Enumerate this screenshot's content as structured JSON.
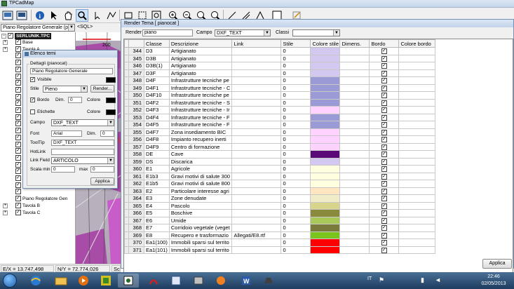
{
  "app": {
    "title": "TPCadMap",
    "theme_combo": "Piano Regolatore Generale (piar",
    "sql_label": "<SQL>",
    "scale_label": "200"
  },
  "toolbar": {
    "icons": [
      "open-icon",
      "save-icon",
      "info-icon",
      "select-arrow-icon",
      "pan-hand-icon",
      "zoom-icon",
      "pointer-icon",
      "polyline-icon",
      "rectangle-icon",
      "zoom-in-icon",
      "zoom-out-icon",
      "zoom-extent-icon",
      "zoom-window-icon",
      "draw-line-icon",
      "measure-icon",
      "snap-icon",
      "edit-icon"
    ]
  },
  "tree": {
    "root": "SERLUNIK.TPC",
    "items": [
      {
        "label": "Base",
        "expand": "+",
        "checked": true
      },
      {
        "label": "Tavola A",
        "expand": "+",
        "checked": true
      },
      {
        "label": "",
        "expand": "",
        "checked": true
      },
      {
        "label": "",
        "expand": "",
        "checked": true
      },
      {
        "label": "",
        "expand": "",
        "checked": true
      },
      {
        "label": "",
        "expand": "",
        "checked": true
      },
      {
        "label": "",
        "expand": "",
        "checked": true
      },
      {
        "label": "",
        "expand": "",
        "checked": true
      },
      {
        "label": "",
        "expand": "",
        "checked": true
      },
      {
        "label": "",
        "expand": "",
        "checked": true
      },
      {
        "label": "",
        "expand": "",
        "checked": true
      },
      {
        "label": "",
        "expand": "",
        "checked": true
      },
      {
        "label": "",
        "expand": "",
        "checked": true
      },
      {
        "label": "",
        "expand": "",
        "checked": true
      },
      {
        "label": "",
        "expand": "",
        "checked": true
      },
      {
        "label": "",
        "expand": "",
        "checked": true
      },
      {
        "label": "",
        "expand": "",
        "checked": true
      },
      {
        "label": "",
        "expand": "",
        "checked": true
      },
      {
        "label": "",
        "expand": "",
        "checked": true
      },
      {
        "label": "",
        "expand": "",
        "checked": true
      },
      {
        "label": "",
        "expand": "",
        "checked": true
      },
      {
        "label": "",
        "expand": "",
        "checked": true
      },
      {
        "label": "",
        "expand": "",
        "checked": true
      },
      {
        "label": "Piano Regolatore Gen",
        "expand": "",
        "checked": true
      },
      {
        "label": "Tavola B",
        "expand": "+",
        "checked": true
      },
      {
        "label": "Tavola C",
        "expand": "+",
        "checked": true
      }
    ]
  },
  "elenco": {
    "title": "Elenco temi",
    "group_title": "Dettagli (pianocat)",
    "desc_value": "Piano Regolatore Generale",
    "visibile_label": "Visibile",
    "stile_label": "Stile",
    "stile_value": "Pieno",
    "render_button": "Render...",
    "bordo_label": "Bordo",
    "dim_label": "Dim.",
    "dim_value": "0",
    "colore_label": "Colore",
    "etichette_label": "Etichette",
    "colore2_label": "Colore",
    "campo_label": "Campo",
    "campo_value": "DXF_TEXT",
    "font_label": "Font",
    "font_value": "Arial",
    "dim2_label": "Dim.",
    "dim2_value": "0",
    "tooltip_label": "ToolTip",
    "tooltip_value": "DXF_TEXT",
    "hotlink_label": "HotLink",
    "hotlink_value": "",
    "linkfield_label": "Link Field",
    "linkfield_value": "ARTICOLO",
    "scalamin_label": "Scala min",
    "scalamin_value": "0",
    "max_label": "max",
    "max_value": "0",
    "applica_button": "Applica"
  },
  "render": {
    "title": "Render Tema [ pianocat ]",
    "render_label": "Render",
    "render_value": "piano",
    "campo_label": "Campo",
    "campo_value": "DXF_TEXT",
    "classi_label": "Classi",
    "classi_value": "",
    "columns": [
      "",
      "Classe",
      "Descrizione",
      "Link",
      "Stile",
      "Colore stile",
      "Dimens.",
      "Bordo",
      "Colore bordo"
    ],
    "rows": [
      {
        "n": "344",
        "classe": "D3",
        "desc": "Artigianato",
        "link": "",
        "stile": "0",
        "color": "#d2c8f0"
      },
      {
        "n": "345",
        "classe": "D3B",
        "desc": "Artigianato",
        "link": "",
        "stile": "0",
        "color": "#d2c8f0"
      },
      {
        "n": "346",
        "classe": "D3B(1)",
        "desc": "Artigianato",
        "link": "",
        "stile": "0",
        "color": "#d2c8f0"
      },
      {
        "n": "347",
        "classe": "D3F",
        "desc": "Artigianato",
        "link": "",
        "stile": "0",
        "color": "#d2c8f0"
      },
      {
        "n": "348",
        "classe": "D4F",
        "desc": "Infrastrutture tecniche pe",
        "link": "",
        "stile": "0",
        "color": "#9a9ad6"
      },
      {
        "n": "349",
        "classe": "D4F1",
        "desc": "Infrastrutture tecniche - C",
        "link": "",
        "stile": "0",
        "color": "#9a9ad6"
      },
      {
        "n": "350",
        "classe": "D4F10",
        "desc": "Infrastrutture tecniche pe",
        "link": "",
        "stile": "0",
        "color": "#9a9ad6"
      },
      {
        "n": "351",
        "classe": "D4F2",
        "desc": "Infrastrutture tecniche - S",
        "link": "",
        "stile": "0",
        "color": "#9a9ad6"
      },
      {
        "n": "352",
        "classe": "D4F3",
        "desc": "Infrastrutture tecniche - Ir",
        "link": "",
        "stile": "0",
        "color": "#ffd2ff"
      },
      {
        "n": "353",
        "classe": "D4F4",
        "desc": "Infrastrutture tecniche - F",
        "link": "",
        "stile": "0",
        "color": "#9a9ad6"
      },
      {
        "n": "354",
        "classe": "D4F5",
        "desc": "Infrastrutture tecniche - F",
        "link": "",
        "stile": "0",
        "color": "#9a9ad6"
      },
      {
        "n": "355",
        "classe": "D4F7",
        "desc": "Zona insediamento BIC",
        "link": "",
        "stile": "0",
        "color": "#ffd2ff"
      },
      {
        "n": "356",
        "classe": "D4F8",
        "desc": "Impianto recupero inerti",
        "link": "",
        "stile": "0",
        "color": "#ffd2ff"
      },
      {
        "n": "357",
        "classe": "D4F9",
        "desc": "Centro di formazione",
        "link": "",
        "stile": "0",
        "color": "#ffd2ff"
      },
      {
        "n": "358",
        "classe": "DE",
        "desc": "Cave",
        "link": "",
        "stile": "0",
        "color": "#5a0a78"
      },
      {
        "n": "359",
        "classe": "DS",
        "desc": "Discarica",
        "link": "",
        "stile": "0",
        "color": "#d2c8f0"
      },
      {
        "n": "360",
        "classe": "E1",
        "desc": "Agricole",
        "link": "",
        "stile": "0",
        "color": "#ffffe0"
      },
      {
        "n": "361",
        "classe": "E1b3",
        "desc": "Gravi motivi di salute 300",
        "link": "",
        "stile": "0",
        "color": "#ffffe0"
      },
      {
        "n": "362",
        "classe": "E1b5",
        "desc": "Gravi motivi di salute 800",
        "link": "",
        "stile": "0",
        "color": "#ffffe0"
      },
      {
        "n": "363",
        "classe": "E2",
        "desc": "Particolare interesse agri",
        "link": "",
        "stile": "0",
        "color": "#ffe6c0"
      },
      {
        "n": "364",
        "classe": "E3",
        "desc": "Zone denudate",
        "link": "",
        "stile": "0",
        "color": "#f0ecc8"
      },
      {
        "n": "365",
        "classe": "E4",
        "desc": "Pascolo",
        "link": "",
        "stile": "0",
        "color": "#d8d48c"
      },
      {
        "n": "366",
        "classe": "E5",
        "desc": "Boschive",
        "link": "",
        "stile": "0",
        "color": "#8a8a3c"
      },
      {
        "n": "367",
        "classe": "E6",
        "desc": "Umide",
        "link": "",
        "stile": "0",
        "color": "#a8c85a"
      },
      {
        "n": "368",
        "classe": "E7",
        "desc": "Corridoio vegetale (veget",
        "link": "",
        "stile": "0",
        "color": "#7a7a3a"
      },
      {
        "n": "369",
        "classe": "E8",
        "desc": "Recupero e trasformazio",
        "link": "Allegati/E8.rtf",
        "stile": "0",
        "color": "#7ac41e"
      },
      {
        "n": "370",
        "classe": "Ea1(100)",
        "desc": "Immobili sparsi sul territo",
        "link": "",
        "stile": "0",
        "color": "#ff0000"
      },
      {
        "n": "371",
        "classe": "Ea1(101)",
        "desc": "Immobili sparsi sul territo",
        "link": "",
        "stile": "0",
        "color": "#ff0000"
      }
    ],
    "applica_button": "Applica"
  },
  "status": {
    "ex": "E/X = 13.747,498",
    "ny": "N/Y = 72.774,026",
    "sc": "Sc"
  },
  "taskbar": {
    "tray_lang": "IT",
    "time": "22:46",
    "date": "02/05/2013"
  }
}
